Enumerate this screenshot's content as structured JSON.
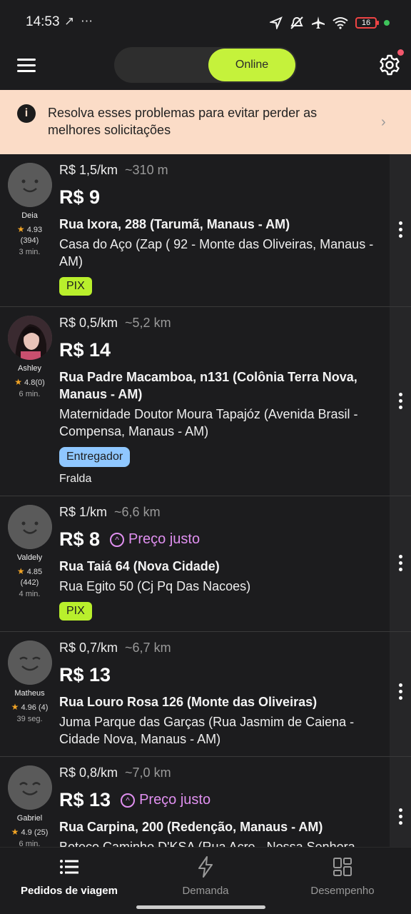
{
  "status": {
    "time": "14:53",
    "extra_icons": "↗ ⋯",
    "battery": "16"
  },
  "header": {
    "toggle_label": "Online"
  },
  "banner": {
    "text": "Resolva esses problemas para evitar perder as melhores solicitações",
    "icon": "info-icon"
  },
  "orders": [
    {
      "name": "Deia",
      "rating": "4.93",
      "count": "(394)",
      "time": "3 min.",
      "rate": "R$ 1,5/km",
      "distance": "~310 m",
      "price": "R$ 9",
      "fair": "",
      "pickup": "Rua Ixora, 288 (Tarumã, Manaus - AM)",
      "dest": "Casa do Aço (Zap ( 92 - Monte das Oliveiras, Manaus - AM)",
      "tag": "PIX",
      "note": ""
    },
    {
      "name": "Ashley",
      "rating": "4.8",
      "count": "(0)",
      "time": "6 min.",
      "rate": "R$ 0,5/km",
      "distance": "~5,2 km",
      "price": "R$ 14",
      "fair": "",
      "pickup": "Rua Padre Macamboa, n131 (Colônia Terra Nova, Manaus - AM)",
      "dest": "Maternidade Doutor Moura Tapajóz (Avenida Brasil - Compensa, Manaus - AM)",
      "tag": "Entregador",
      "note": "Fralda"
    },
    {
      "name": "Valdely",
      "rating": "4.85",
      "count": "(442)",
      "time": "4 min.",
      "rate": "R$ 1/km",
      "distance": "~6,6 km",
      "price": "R$ 8",
      "fair": "Preço justo",
      "pickup": "Rua Taiá 64 (Nova Cidade)",
      "dest": "Rua Egito 50 (Cj Pq Das Nacoes)",
      "tag": "PIX",
      "note": ""
    },
    {
      "name": "Matheus",
      "rating": "4.96",
      "count": "(4)",
      "time": "39 seg.",
      "rate": "R$ 0,7/km",
      "distance": "~6,7 km",
      "price": "R$ 13",
      "fair": "",
      "pickup": "Rua Louro Rosa 126 (Monte das Oliveiras)",
      "dest": "Juma Parque das Garças (Rua Jasmim de Caiena - Cidade Nova, Manaus - AM)",
      "tag": "",
      "note": ""
    },
    {
      "name": "Gabriel",
      "rating": "4.9",
      "count": "(25)",
      "time": "6 min.",
      "rate": "R$ 0,8/km",
      "distance": "~7,0 km",
      "price": "R$ 13",
      "fair": "Preço justo",
      "pickup": "Rua Carpina, 200 (Redenção, Manaus - AM)",
      "dest": "Boteco Caminho D'KSA (Rua Acre - Nossa Senhora",
      "tag": "",
      "note": ""
    }
  ],
  "nav": {
    "orders": "Pedidos de viagem",
    "demand": "Demanda",
    "performance": "Desempenho"
  }
}
